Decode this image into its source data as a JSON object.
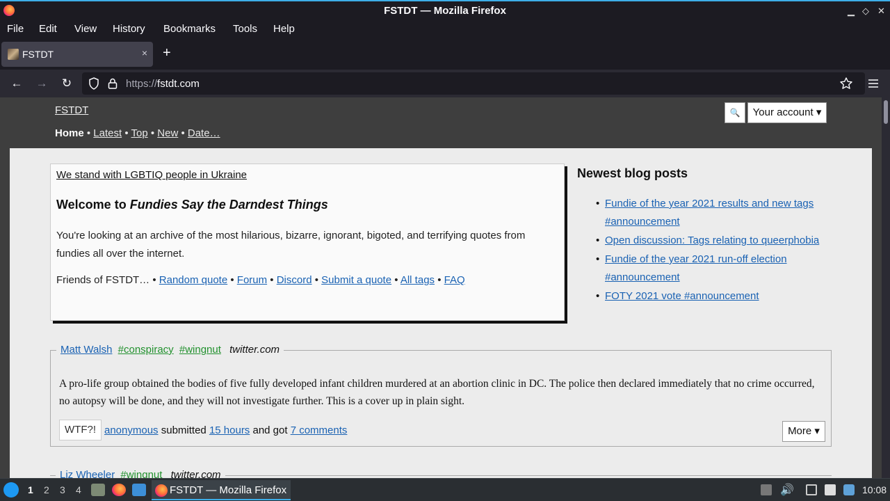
{
  "window": {
    "title": "FSTDT — Mozilla Firefox"
  },
  "menu": [
    "File",
    "Edit",
    "View",
    "History",
    "Bookmarks",
    "Tools",
    "Help"
  ],
  "tab": {
    "title": "FSTDT",
    "close": "×",
    "new": "+"
  },
  "nav": {
    "url_scheme": "https://",
    "url_host": "fstdt.com"
  },
  "site": {
    "name": "FSTDT",
    "nav": {
      "home": "Home",
      "latest": "Latest",
      "top": "Top",
      "new": "New",
      "date": "Date…",
      "sep": " • "
    },
    "search_icon": "🔍",
    "account": "Your account ▾"
  },
  "welcome": {
    "ukraine": "We stand with LGBTIQ people in Ukraine",
    "heading_prefix": "Welcome to ",
    "heading_italic": "Fundies Say the Darndest Things",
    "description": "You're looking at an archive of the most hilarious, bizarre, ignorant, bigoted, and terrifying quotes from fundies all over the internet.",
    "links": {
      "friends": "Friends of FSTDT…",
      "random": "Random quote",
      "forum": "Forum",
      "discord": "Discord",
      "submit": "Submit a quote",
      "tags": "All tags",
      "faq": "FAQ",
      "sep": " • "
    }
  },
  "blog": {
    "heading": "Newest blog posts",
    "posts": [
      "Fundie of the year 2021 results and new tags #announcement",
      "Open discussion: Tags relating to queerphobia",
      "Fundie of the year 2021 run-off election #announcement",
      "FOTY 2021 vote #announcement"
    ]
  },
  "quotes": [
    {
      "author": "Matt Walsh",
      "tags": [
        "#conspiracy",
        "#wingnut"
      ],
      "source": "twitter.com",
      "body": "A pro-life group obtained the bodies of five fully developed infant children murdered at an abortion clinic in DC. The police then declared immediately that no crime occurred, no autopsy will be done, and they will not investigate further. This is a cover up in plain sight.",
      "wtf": "WTF?!",
      "submitter": "anonymous",
      "submitted_text": " submitted ",
      "time": "15 hours",
      "got_text": " and got ",
      "comments": "7 comments",
      "more": "More ▾"
    },
    {
      "author": "Liz Wheeler",
      "tags": [
        "#wingnut"
      ],
      "source": "twitter.com"
    }
  ],
  "taskbar": {
    "desktops": [
      "1",
      "2",
      "3",
      "4"
    ],
    "task": "FSTDT — Mozilla Firefox",
    "clock": "10:08"
  }
}
